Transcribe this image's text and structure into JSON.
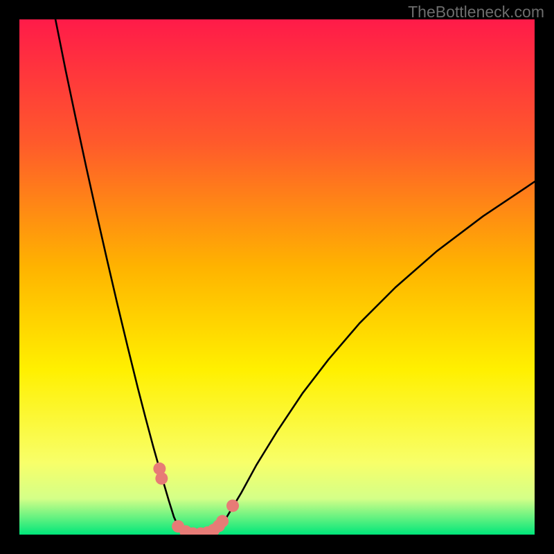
{
  "watermark": "TheBottleneck.com",
  "colors": {
    "frame": "#000000",
    "grad_top": "#ff1b49",
    "grad_mid1": "#ff5a2b",
    "grad_mid2": "#ffb300",
    "grad_mid3": "#fff000",
    "grad_mid4": "#f8ff69",
    "grad_low": "#d4ff88",
    "grad_bottom": "#00e67a",
    "curve": "#000000",
    "marker": "#e77b76"
  },
  "chart_data": {
    "type": "line",
    "title": "",
    "xlabel": "",
    "ylabel": "",
    "xlim": [
      0,
      100
    ],
    "ylim": [
      0,
      100
    ],
    "series": [
      {
        "name": "left-branch",
        "x": [
          7,
          9,
          11,
          13,
          15,
          17,
          19,
          21,
          23,
          24.5,
          26,
          27.5,
          29,
          30,
          31,
          32
        ],
        "y": [
          100,
          90,
          80.5,
          71.2,
          62.2,
          53.4,
          44.8,
          36.5,
          28.4,
          22.6,
          17.0,
          11.7,
          6.6,
          3.4,
          1.2,
          0.3
        ]
      },
      {
        "name": "floor",
        "x": [
          32,
          33,
          34,
          35,
          36,
          37,
          38
        ],
        "y": [
          0.3,
          0.1,
          0.0,
          0.0,
          0.1,
          0.3,
          0.6
        ]
      },
      {
        "name": "right-branch",
        "x": [
          38,
          40,
          43,
          46,
          50,
          55,
          60,
          66,
          73,
          81,
          90,
          100
        ],
        "y": [
          0.6,
          3.0,
          8.0,
          13.5,
          20.0,
          27.5,
          34.0,
          41.0,
          48.0,
          55.0,
          61.8,
          68.5
        ]
      }
    ],
    "markers": {
      "name": "highlight-dots",
      "x": [
        27.2,
        27.6,
        30.8,
        32.3,
        33.7,
        35.2,
        36.5,
        37.7,
        38.7,
        39.4,
        41.4
      ],
      "y": [
        12.8,
        10.9,
        1.6,
        0.6,
        0.2,
        0.2,
        0.4,
        0.9,
        1.7,
        2.6,
        5.6
      ]
    }
  }
}
